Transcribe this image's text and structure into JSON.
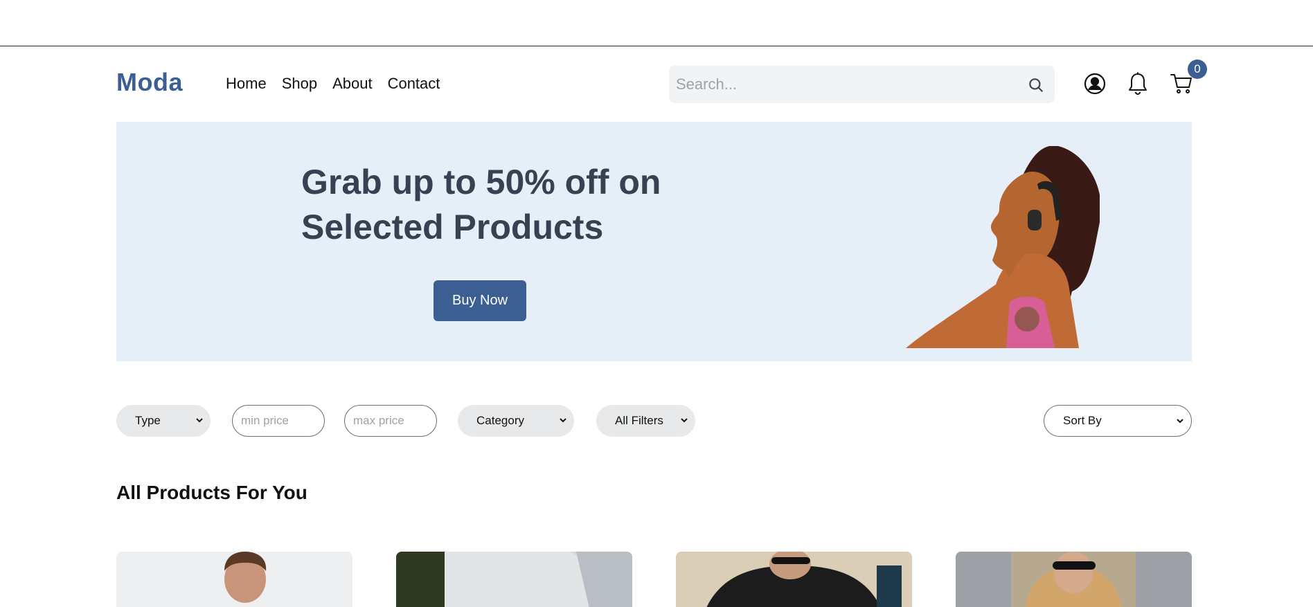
{
  "brand": {
    "logo": "Moda",
    "accent": "#3b5f93"
  },
  "nav": {
    "items": [
      "Home",
      "Shop",
      "About",
      "Contact"
    ]
  },
  "search": {
    "placeholder": "Search..."
  },
  "header_icons": [
    "search-icon",
    "user-icon",
    "bell-icon",
    "cart-icon"
  ],
  "cart": {
    "count": "0"
  },
  "hero": {
    "title_line1": "Grab up to 50% off on",
    "title_line2": "Selected Products",
    "cta": "Buy Now",
    "background": "#e6eef8"
  },
  "filters": {
    "type": "Type",
    "min_price_placeholder": "min price",
    "max_price_placeholder": "max price",
    "category": "Category",
    "all_filters": "All Filters",
    "sort": "Sort By"
  },
  "products": {
    "section_title": "All Products For You"
  }
}
